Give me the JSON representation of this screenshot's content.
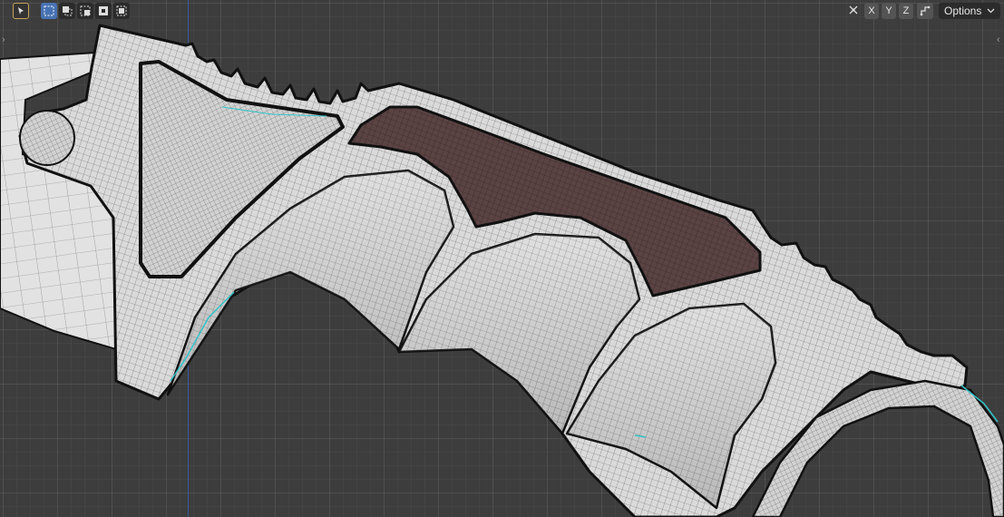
{
  "viewport": {
    "name": "3D Viewport",
    "background_color": "#3d3d3d",
    "model_fill": "#dcdcdc",
    "selected_face_color": "#5a4444",
    "highlight_edge_color": "#33c3c9"
  },
  "header_left": {
    "tools": [
      {
        "icon": "select-cursor-icon",
        "active": false
      },
      {
        "icon": "select-box-new-icon",
        "active": true
      },
      {
        "icon": "select-box-extend-icon",
        "active": false
      },
      {
        "icon": "select-box-subtract-icon",
        "active": false
      },
      {
        "icon": "select-box-intersect-icon",
        "active": false
      }
    ]
  },
  "header_right": {
    "mirror_icon": "mirror-icon",
    "axes": [
      "X",
      "Y",
      "Z"
    ],
    "overlay_icon": "overlay-icon",
    "options_label": "Options"
  }
}
